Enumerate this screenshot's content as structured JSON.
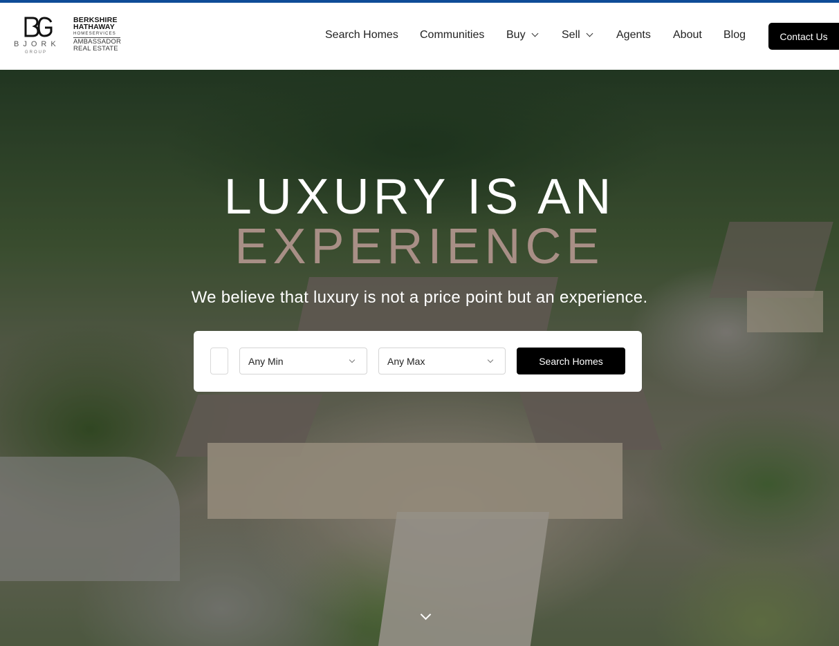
{
  "brand": {
    "bjork": "BJORK",
    "group": "GROUP",
    "bh_line1": "BERKSHIRE",
    "bh_line2": "HATHAWAY",
    "bh_line3": "HOMESERVICES",
    "bh_line4": "AMBASSADOR",
    "bh_line5": "REAL ESTATE"
  },
  "nav": {
    "items": [
      {
        "label": "Search Homes"
      },
      {
        "label": "Communities"
      },
      {
        "label": "Buy",
        "icon": "chevron-down-icon"
      },
      {
        "label": "Sell",
        "icon": "chevron-down-icon"
      },
      {
        "label": "Agents"
      },
      {
        "label": "About"
      },
      {
        "label": "Blog"
      }
    ],
    "contact_label": "Contact Us"
  },
  "hero": {
    "headline_line1": "LUXURY IS AN",
    "headline_line2": "EXPERIENCE",
    "tagline": "We believe that luxury is not a price point but an experience."
  },
  "search": {
    "location_value": "",
    "min_price": "Any Min",
    "max_price": "Any Max",
    "button_label": "Search Homes"
  },
  "colors": {
    "accent_bar": "#0f4c97",
    "headline_accent": "#a88f86",
    "button": "#000000"
  }
}
